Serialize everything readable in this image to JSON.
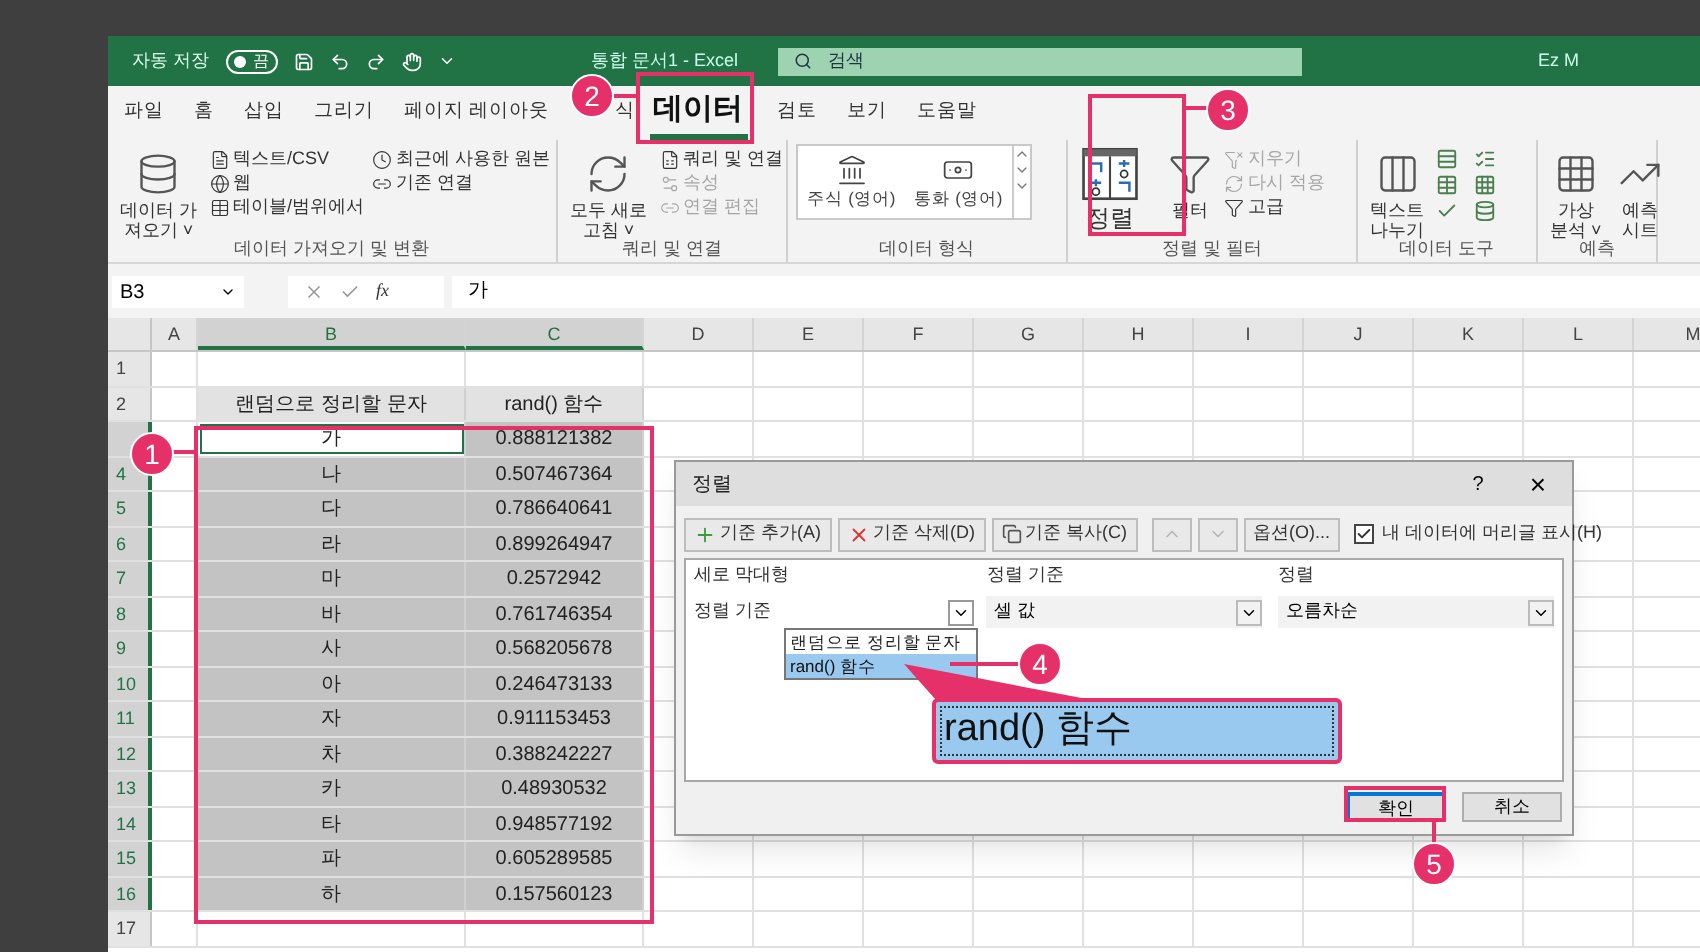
{
  "title_bar": {
    "autosave_label": "자동 저장",
    "autosave_toggle": {
      "text": "끔",
      "on": false
    },
    "document_title": "통합 문서1 - Excel",
    "search": {
      "placeholder": "검색"
    },
    "user": "Ez M"
  },
  "menu_tabs": [
    {
      "label": "파일",
      "selected": false
    },
    {
      "label": "홈",
      "selected": false
    },
    {
      "label": "삽입",
      "selected": false
    },
    {
      "label": "그리기",
      "selected": false
    },
    {
      "label": "페이지 레이아웃",
      "selected": false
    },
    {
      "label": "식",
      "selected": false
    },
    {
      "label": "데이터",
      "selected": true
    },
    {
      "label": "검토",
      "selected": false
    },
    {
      "label": "보기",
      "selected": false
    },
    {
      "label": "도움말",
      "selected": false
    }
  ],
  "ribbon_groups": [
    {
      "label": "데이터 가져오기 및 변환",
      "columns": [
        {
          "kind": "large",
          "lines": [
            "데이터 가",
            "져오기 ˅"
          ]
        },
        {
          "kind": "stack",
          "items": [
            {
              "label": "텍스트/CSV",
              "disabled": false
            },
            {
              "label": "웹",
              "disabled": false
            },
            {
              "label": "테이블/범위에서",
              "disabled": false
            }
          ]
        },
        {
          "kind": "stack",
          "items": [
            {
              "label": "최근에 사용한 원본",
              "disabled": false
            },
            {
              "label": "기존 연결",
              "disabled": false
            }
          ]
        }
      ]
    },
    {
      "label": "쿼리 및 연결",
      "columns": [
        {
          "kind": "large",
          "lines": [
            "모두 새로",
            "고침 ˅"
          ]
        },
        {
          "kind": "stack",
          "items": [
            {
              "label": "쿼리 및 연결",
              "disabled": false
            },
            {
              "label": "속성",
              "disabled": true
            },
            {
              "label": "연결 편집",
              "disabled": true
            }
          ]
        }
      ]
    },
    {
      "label": "데이터 형식",
      "columns": [
        {
          "kind": "gallery",
          "items": [
            {
              "label": "주식 (영어)"
            },
            {
              "label": "통화 (영어)"
            }
          ]
        }
      ]
    },
    {
      "label": "정렬 및 필터",
      "columns": [
        {
          "kind": "large",
          "lines": [
            "정렬"
          ]
        },
        {
          "kind": "large",
          "lines": [
            "필터"
          ]
        },
        {
          "kind": "stack",
          "items": [
            {
              "label": "지우기",
              "disabled": true
            },
            {
              "label": "다시 적용",
              "disabled": true
            },
            {
              "label": "고급",
              "disabled": false
            }
          ]
        }
      ]
    },
    {
      "label": "데이터 도구",
      "columns": [
        {
          "kind": "large",
          "lines": [
            "텍스트",
            "나누기"
          ]
        },
        {
          "kind": "icons"
        }
      ]
    },
    {
      "label": "예측",
      "columns": [
        {
          "kind": "large",
          "lines": [
            "가상",
            "분석 ˅"
          ]
        },
        {
          "kind": "large",
          "lines": [
            "예측",
            "시트"
          ]
        }
      ]
    }
  ],
  "formula_bar": {
    "name_box": "B3",
    "fx": "fx",
    "value": "가"
  },
  "sheet": {
    "columns": [
      {
        "label": "A",
        "selected": false
      },
      {
        "label": "B",
        "selected": true
      },
      {
        "label": "C",
        "selected": true
      },
      {
        "label": "D",
        "selected": false
      },
      {
        "label": "E",
        "selected": false
      },
      {
        "label": "F",
        "selected": false
      },
      {
        "label": "G",
        "selected": false
      },
      {
        "label": "H",
        "selected": false
      },
      {
        "label": "I",
        "selected": false
      },
      {
        "label": "J",
        "selected": false
      },
      {
        "label": "K",
        "selected": false
      },
      {
        "label": "L",
        "selected": false
      },
      {
        "label": "M",
        "selected": false
      }
    ],
    "rows": [
      {
        "number": "1",
        "selected": false
      },
      {
        "number": "2",
        "selected": false,
        "cells": [
          {
            "text": "랜덤으로 정리할 문자",
            "kind": "header",
            "active": false
          },
          {
            "text": "rand() 함수",
            "kind": "header",
            "active": false
          }
        ]
      },
      {
        "selected": true,
        "cells": [
          {
            "text": "가",
            "kind": "data",
            "active": true
          },
          {
            "text": "0.888121382",
            "kind": "data",
            "selected": true,
            "active": false
          }
        ]
      },
      {
        "number": "4",
        "selected": true,
        "cells": [
          {
            "text": "나",
            "kind": "data",
            "selected": true,
            "active": false
          },
          {
            "text": "0.507467364",
            "kind": "data",
            "selected": true,
            "active": false
          }
        ]
      },
      {
        "number": "5",
        "selected": true,
        "cells": [
          {
            "text": "다",
            "kind": "data",
            "selected": true,
            "active": false
          },
          {
            "text": "0.786640641",
            "kind": "data",
            "selected": true,
            "active": false
          }
        ]
      },
      {
        "number": "6",
        "selected": true,
        "cells": [
          {
            "text": "라",
            "kind": "data",
            "selected": true,
            "active": false
          },
          {
            "text": "0.899264947",
            "kind": "data",
            "selected": true,
            "active": false
          }
        ]
      },
      {
        "number": "7",
        "selected": true,
        "cells": [
          {
            "text": "마",
            "kind": "data",
            "selected": true,
            "active": false
          },
          {
            "text": "0.2572942",
            "kind": "data",
            "selected": true,
            "active": false
          }
        ]
      },
      {
        "number": "8",
        "selected": true,
        "cells": [
          {
            "text": "바",
            "kind": "data",
            "selected": true,
            "active": false
          },
          {
            "text": "0.761746354",
            "kind": "data",
            "selected": true,
            "active": false
          }
        ]
      },
      {
        "number": "9",
        "selected": true,
        "cells": [
          {
            "text": "사",
            "kind": "data",
            "selected": true,
            "active": false
          },
          {
            "text": "0.568205678",
            "kind": "data",
            "selected": true,
            "active": false
          }
        ]
      },
      {
        "number": "10",
        "selected": true,
        "cells": [
          {
            "text": "아",
            "kind": "data",
            "selected": true,
            "active": false
          },
          {
            "text": "0.246473133",
            "kind": "data",
            "selected": true,
            "active": false
          }
        ]
      },
      {
        "number": "11",
        "selected": true,
        "cells": [
          {
            "text": "자",
            "kind": "data",
            "selected": true,
            "active": false
          },
          {
            "text": "0.911153453",
            "kind": "data",
            "selected": true,
            "active": false
          }
        ]
      },
      {
        "number": "12",
        "selected": true,
        "cells": [
          {
            "text": "차",
            "kind": "data",
            "selected": true,
            "active": false
          },
          {
            "text": "0.388242227",
            "kind": "data",
            "selected": true,
            "active": false
          }
        ]
      },
      {
        "number": "13",
        "selected": true,
        "cells": [
          {
            "text": "카",
            "kind": "data",
            "selected": true,
            "active": false
          },
          {
            "text": "0.48930532",
            "kind": "data",
            "selected": true,
            "active": false
          }
        ]
      },
      {
        "number": "14",
        "selected": true,
        "cells": [
          {
            "text": "타",
            "kind": "data",
            "selected": true,
            "active": false
          },
          {
            "text": "0.948577192",
            "kind": "data",
            "selected": true,
            "active": false
          }
        ]
      },
      {
        "number": "15",
        "selected": true,
        "cells": [
          {
            "text": "파",
            "kind": "data",
            "selected": true,
            "active": false
          },
          {
            "text": "0.605289585",
            "kind": "data",
            "selected": true,
            "active": false
          }
        ]
      },
      {
        "number": "16",
        "selected": true,
        "cells": [
          {
            "text": "하",
            "kind": "data",
            "selected": true,
            "active": false
          },
          {
            "text": "0.157560123",
            "kind": "data",
            "selected": true,
            "active": false
          }
        ]
      },
      {
        "number": "17",
        "selected": false
      }
    ]
  },
  "sort_dialog": {
    "title": "정렬",
    "help": "?",
    "close": "×",
    "toolbar": [
      {
        "kind": "add",
        "label": "기준 추가(A)",
        "disabled": false
      },
      {
        "kind": "delete",
        "label": "기준 삭제(D)",
        "disabled": false
      },
      {
        "kind": "copy",
        "label": "기준 복사(C)",
        "disabled": false
      },
      {
        "kind": "up",
        "disabled": true
      },
      {
        "kind": "down",
        "disabled": true
      },
      {
        "kind": "options",
        "label": "옵션(O)...",
        "disabled": false
      }
    ],
    "header_checkbox": {
      "label": "내 데이터에 머리글 표시(H)",
      "checked": true
    },
    "columns": [
      "세로 막대형",
      "정렬 기준",
      "정렬"
    ],
    "rows": [
      {
        "label": "정렬 기준",
        "sort_on": "셀 값",
        "order": "오름차순"
      }
    ],
    "dropdown_items": [
      {
        "label": "랜덤으로 정리할 문자",
        "selected": false
      },
      {
        "label": "rand() 함수",
        "selected": true
      }
    ],
    "buttons": [
      {
        "label": "확인",
        "default": true
      },
      {
        "label": "취소",
        "default": false
      }
    ]
  },
  "annotations": {
    "badges": [
      "1",
      "2",
      "3",
      "4",
      "5"
    ],
    "callout": "rand() 함수"
  }
}
